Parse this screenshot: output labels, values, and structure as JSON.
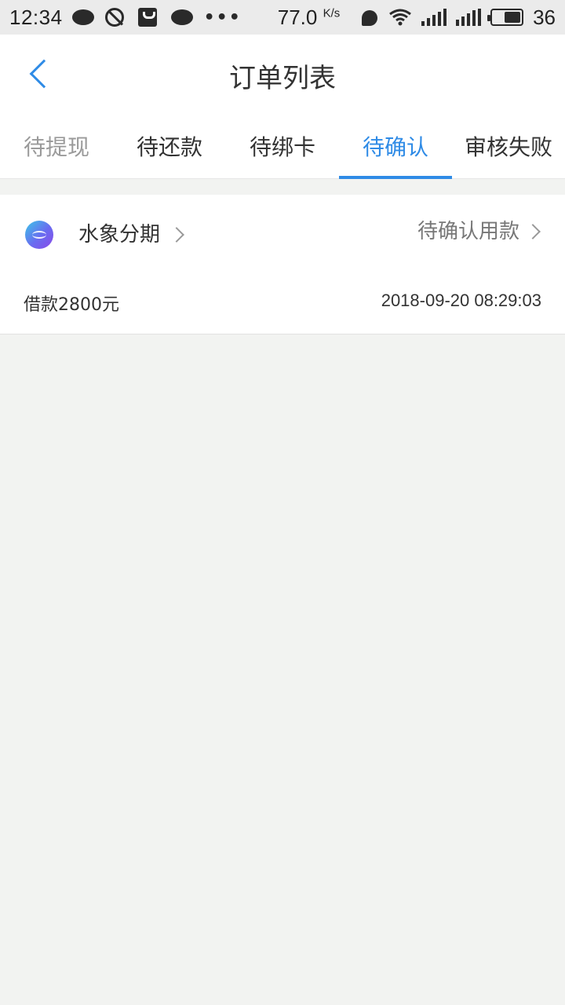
{
  "status_bar": {
    "time": "12:34",
    "net_speed": "77.0",
    "net_speed_unit": "K/s",
    "battery_level": "36"
  },
  "header": {
    "title": "订单列表",
    "back_icon": "chevron-left-icon"
  },
  "tabs": [
    {
      "label": "待提现",
      "active": false
    },
    {
      "label": "待还款",
      "active": false
    },
    {
      "label": "待绑卡",
      "active": false
    },
    {
      "label": "待确认",
      "active": true
    },
    {
      "label": "审核失败",
      "active": false
    }
  ],
  "orders": [
    {
      "app_name": "水象分期",
      "status": "待确认用款",
      "amount": "借款2800元",
      "time": "2018-09-20 08:29:03"
    }
  ],
  "colors": {
    "accent": "#2f8be6",
    "background": "#f2f3f1"
  }
}
